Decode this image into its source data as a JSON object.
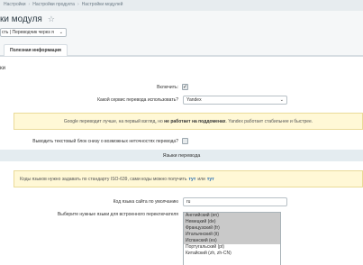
{
  "breadcrumbs": [
    "Настройки",
    "Настройки продукта",
    "Настройки модулей"
  ],
  "page_title": "ки модуля",
  "site_select": {
    "value": "сть | Переводчик через я",
    "open_icon": "chevron-down-icon"
  },
  "tabs": [
    {
      "label": "Полезная информация"
    }
  ],
  "section_label": "ки",
  "enable": {
    "label": "Включить:",
    "checked": true
  },
  "service": {
    "label": "Какой сервис перевода использовать?",
    "value": "Yandex"
  },
  "notice_google": {
    "before": "Google переводит лучше, на первый взгляд, но",
    "bold": "не работает на поддоменах",
    "after": ". Yandex работает стабильнее и быстрее."
  },
  "show_text_block": {
    "label": "Выводить текстовый блок снизу о возможных неточностях перевода?",
    "checked": false
  },
  "languages_header": "Языки перевода",
  "notice_iso": {
    "before": "Коды языков нужно задавать по стандарту ISO-639, сами коды можно получить",
    "link1": "тут",
    "middle": "или",
    "link2": "тут"
  },
  "default_lang": {
    "label": "Код языка сайта по умолчанию",
    "value": "ru"
  },
  "langs_list": {
    "label": "Выберите нужные языки для встроенного переключателя",
    "options": [
      {
        "text": "Английский (en)",
        "selected": true
      },
      {
        "text": "Немецкий (de)",
        "selected": true
      },
      {
        "text": "Французский (fr)",
        "selected": true
      },
      {
        "text": "Итальянский (it)",
        "selected": true
      },
      {
        "text": "Испанский (es)",
        "selected": true
      },
      {
        "text": "Португальский (pt)",
        "selected": false
      },
      {
        "text": "Китайский (zh, zh-CN)",
        "selected": false
      }
    ]
  },
  "icons": {
    "favorite": "star-icon",
    "checkmark": "check-icon"
  }
}
